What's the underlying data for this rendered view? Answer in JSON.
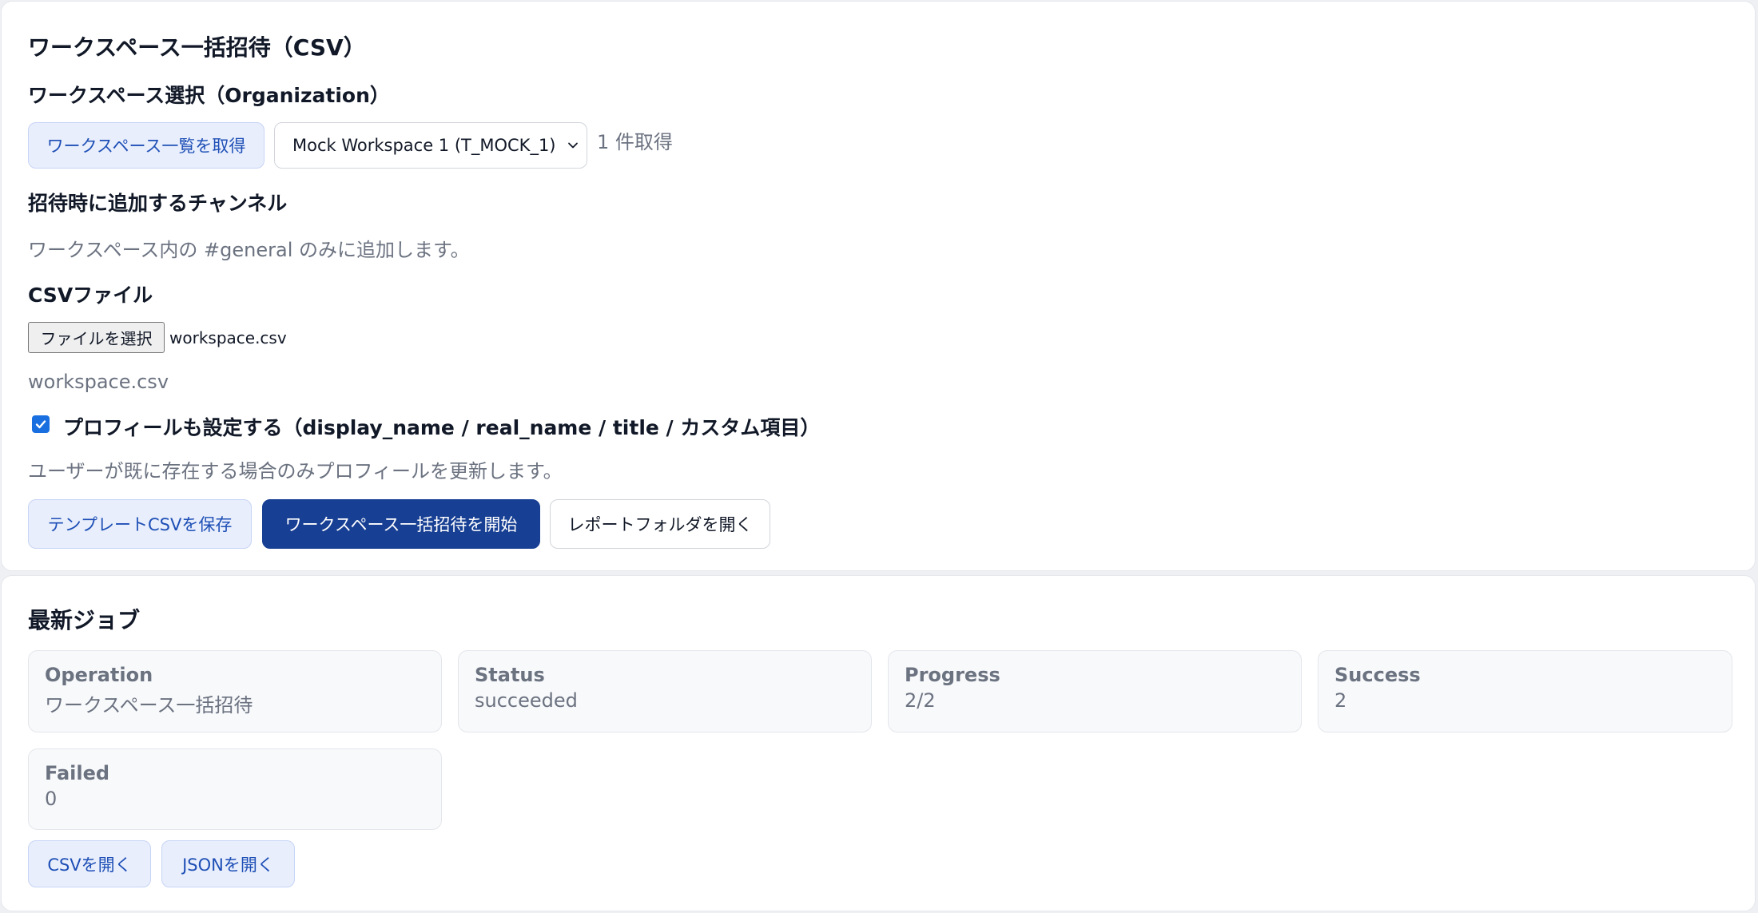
{
  "invite": {
    "title": "ワークスペース一括招待（CSV）",
    "workspace_heading": "ワークスペース選択（Organization）",
    "fetch_button": "ワークスペース一覧を取得",
    "workspace_selected": "Mock Workspace 1 (T_MOCK_1)",
    "fetch_count": "1 件取得",
    "channel_heading": "招待時に追加するチャンネル",
    "channel_note": "ワークスペース内の #general のみに追加します。",
    "csv_heading": "CSVファイル",
    "file_button": "ファイルを選択",
    "file_name": "workspace.csv",
    "file_path": "workspace.csv",
    "profile_checked": true,
    "profile_label": "プロフィールも設定する（display_name / real_name / title / カスタム項目）",
    "profile_note": "ユーザーが既に存在する場合のみプロフィールを更新します。",
    "save_template_button": "テンプレートCSVを保存",
    "start_button": "ワークスペース一括招待を開始",
    "open_report_button": "レポートフォルダを開く"
  },
  "job": {
    "title": "最新ジョブ",
    "stats": [
      {
        "label": "Operation",
        "value": "ワークスペース一括招待"
      },
      {
        "label": "Status",
        "value": "succeeded"
      },
      {
        "label": "Progress",
        "value": "2/2"
      },
      {
        "label": "Success",
        "value": "2"
      },
      {
        "label": "Failed",
        "value": "0"
      }
    ],
    "open_csv_button": "CSVを開く",
    "open_json_button": "JSONを開く"
  },
  "colors": {
    "primary": "#173f93",
    "soft_button_bg": "#e8eefc",
    "soft_button_text": "#1e4fb6",
    "checkbox": "#1a6fe0"
  }
}
